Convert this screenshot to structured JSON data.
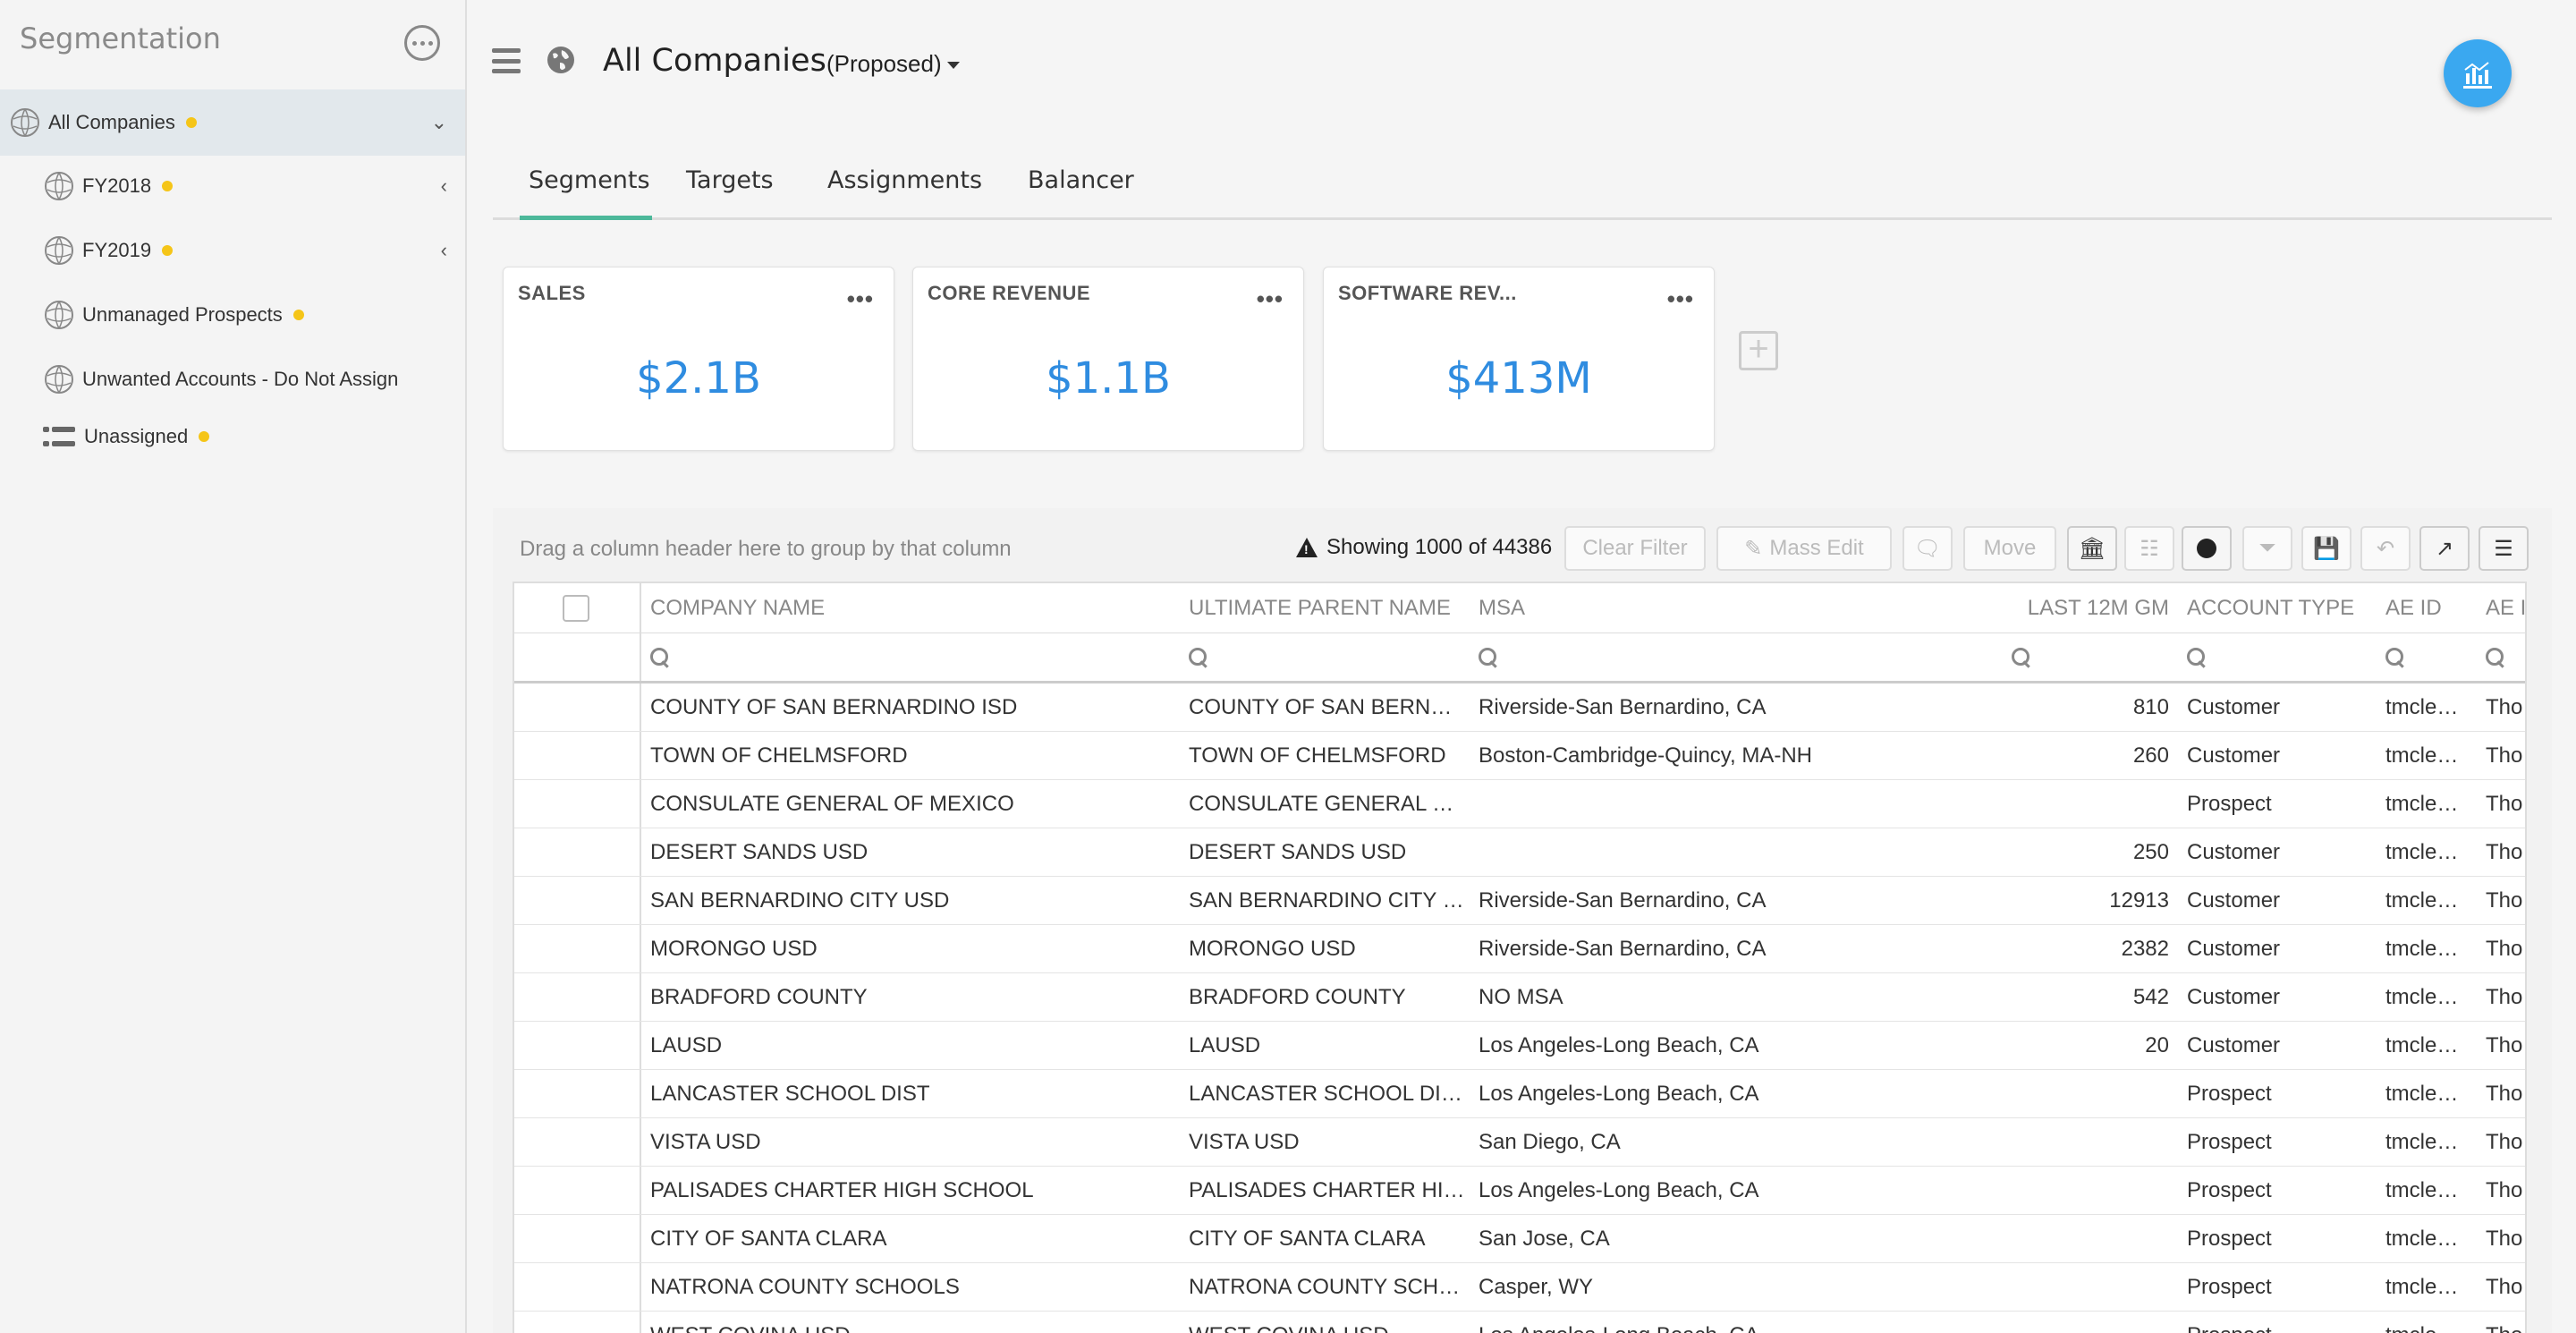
{
  "sidebar": {
    "title": "Segmentation",
    "items": [
      {
        "label": "All Companies",
        "dot": true
      },
      {
        "label": "FY2018",
        "dot": true
      },
      {
        "label": "FY2019",
        "dot": true
      },
      {
        "label": "Unmanaged Prospects",
        "dot": true
      },
      {
        "label": "Unwanted Accounts - Do Not Assign",
        "dot": false
      },
      {
        "label": "Unassigned",
        "dot": true
      }
    ]
  },
  "header": {
    "title": "All Companies",
    "view": "(Proposed)"
  },
  "tabs": [
    "Segments",
    "Targets",
    "Assignments",
    "Balancer"
  ],
  "cards": [
    {
      "title": "SALES",
      "value": "$2.1B"
    },
    {
      "title": "CORE REVENUE",
      "value": "$1.1B"
    },
    {
      "title": "SOFTWARE REV...",
      "value": "$413M"
    }
  ],
  "toolbar": {
    "group_hint": "Drag a column header here to group by that column",
    "showing": "Showing 1000 of 44386",
    "clear_filter": "Clear Filter",
    "mass_edit": "Mass Edit",
    "move": "Move"
  },
  "table": {
    "columns": [
      "COMPANY NAME",
      "ULTIMATE PARENT NAME",
      "MSA",
      "LAST 12M GM",
      "ACCOUNT TYPE",
      "AE ID",
      "AE I"
    ],
    "rows": [
      [
        "COUNTY OF SAN BERNARDINO ISD",
        "COUNTY OF SAN BERN…",
        "Riverside-San Bernardino, CA",
        "810",
        "Customer",
        "tmcle…",
        "Tho"
      ],
      [
        "TOWN OF CHELMSFORD",
        "TOWN OF CHELMSFORD",
        "Boston-Cambridge-Quincy, MA-NH",
        "260",
        "Customer",
        "tmcle…",
        "Tho"
      ],
      [
        "CONSULATE GENERAL OF MEXICO",
        "CONSULATE GENERAL …",
        "",
        "",
        "Prospect",
        "tmcle…",
        "Tho"
      ],
      [
        "DESERT SANDS USD",
        "DESERT SANDS USD",
        "",
        "250",
        "Customer",
        "tmcle…",
        "Tho"
      ],
      [
        "SAN BERNARDINO CITY USD",
        "SAN BERNARDINO CITY …",
        "Riverside-San Bernardino, CA",
        "12913",
        "Customer",
        "tmcle…",
        "Tho"
      ],
      [
        "MORONGO USD",
        "MORONGO USD",
        "Riverside-San Bernardino, CA",
        "2382",
        "Customer",
        "tmcle…",
        "Tho"
      ],
      [
        "BRADFORD COUNTY",
        "BRADFORD COUNTY",
        "NO MSA",
        "542",
        "Customer",
        "tmcle…",
        "Tho"
      ],
      [
        "LAUSD",
        "LAUSD",
        "Los Angeles-Long Beach, CA",
        "20",
        "Customer",
        "tmcle…",
        "Tho"
      ],
      [
        "LANCASTER SCHOOL DIST",
        "LANCASTER SCHOOL DI…",
        "Los Angeles-Long Beach, CA",
        "",
        "Prospect",
        "tmcle…",
        "Tho"
      ],
      [
        "VISTA USD",
        "VISTA USD",
        "San Diego, CA",
        "",
        "Prospect",
        "tmcle…",
        "Tho"
      ],
      [
        "PALISADES CHARTER HIGH SCHOOL",
        "PALISADES CHARTER HI…",
        "Los Angeles-Long Beach, CA",
        "",
        "Prospect",
        "tmcle…",
        "Tho"
      ],
      [
        "CITY OF SANTA CLARA",
        "CITY OF SANTA CLARA",
        "San Jose, CA",
        "",
        "Prospect",
        "tmcle…",
        "Tho"
      ],
      [
        "NATRONA COUNTY SCHOOLS",
        "NATRONA COUNTY SCH…",
        "Casper, WY",
        "",
        "Prospect",
        "tmcle…",
        "Tho"
      ],
      [
        "WEST COVINA USD",
        "WEST COVINA USD",
        "Los Angeles-Long Beach, CA",
        "",
        "Prospect",
        "tmcle…",
        "Tho"
      ]
    ]
  },
  "colors": {
    "accent": "#2f8ce0",
    "tab_underline": "#4cb89a",
    "dot": "#f5c518",
    "fab": "#3aa8f0"
  }
}
